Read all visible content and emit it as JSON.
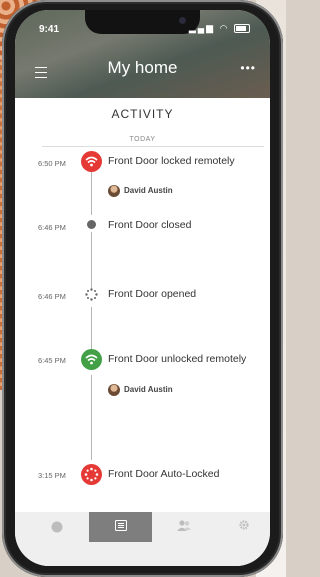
{
  "status": {
    "time": "9:41"
  },
  "header": {
    "title": "My home"
  },
  "activity": {
    "title": "ACTIVITY",
    "section": "TODAY"
  },
  "events": [
    {
      "time": "6:50 PM",
      "text": "Front Door locked remotely",
      "user": "David Austin",
      "icon": "wifi-lock-icon",
      "color": "#e53935"
    },
    {
      "time": "6:46 PM",
      "text": "Front Door closed",
      "icon": "door-closed-dot-icon",
      "color": "#666666"
    },
    {
      "time": "6:46 PM",
      "text": "Front Door opened",
      "icon": "door-opened-icon",
      "color": "#666666"
    },
    {
      "time": "6:45 PM",
      "text": "Front Door unlocked remotely",
      "user": "David Austin",
      "icon": "wifi-unlock-icon",
      "color": "#43a047"
    },
    {
      "time": "3:15 PM",
      "text": "Front Door Auto-Locked",
      "icon": "auto-lock-icon",
      "color": "#e53935"
    }
  ],
  "tabs": [
    {
      "name": "home-tab",
      "icon": "circle-icon",
      "active": false
    },
    {
      "name": "activity-tab",
      "icon": "list-icon",
      "active": true
    },
    {
      "name": "users-tab",
      "icon": "users-icon",
      "active": false
    },
    {
      "name": "settings-tab",
      "icon": "gear-icon",
      "active": false
    }
  ]
}
